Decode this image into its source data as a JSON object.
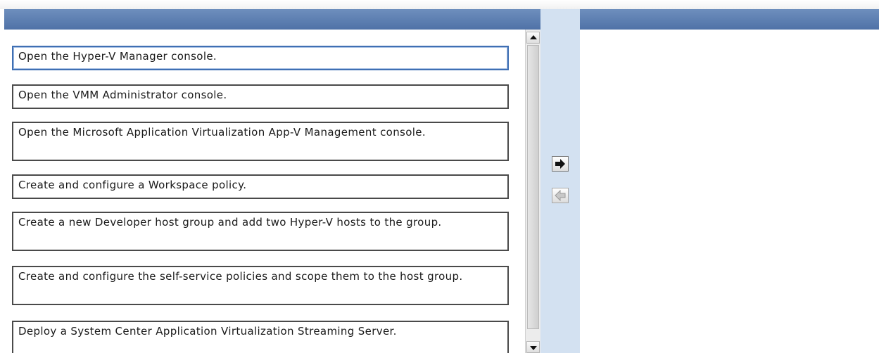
{
  "answer_options": {
    "items": [
      {
        "text": "Open the Hyper-V Manager console."
      },
      {
        "text": "Open the VMM Administrator console."
      },
      {
        "text": "Open the Microsoft Application Virtualization App-V Management console."
      },
      {
        "text": "Create and configure a Workspace policy."
      },
      {
        "text": "Create a new Developer host group and add two Hyper-V hosts to the group."
      },
      {
        "text": "Create and configure the self-service policies and scope them to the host group."
      },
      {
        "text": "Deploy a System Center Application Virtualization Streaming Server."
      }
    ]
  },
  "controls": {
    "move_right_icon": "arrow-right-icon",
    "move_left_icon": "arrow-left-icon",
    "scroll_up_icon": "triangle-up-icon",
    "scroll_down_icon": "triangle-down-icon"
  },
  "colors": {
    "header_blue": "#5579ad",
    "middle_column": "#d3e1f1",
    "selected_border": "#3f6fb3"
  }
}
